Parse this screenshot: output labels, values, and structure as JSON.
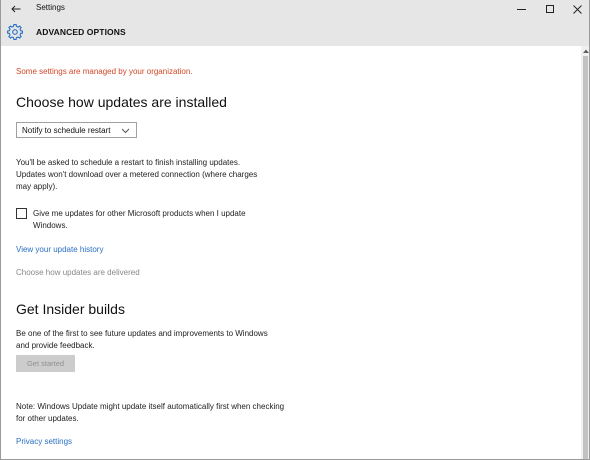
{
  "window": {
    "title": "Settings",
    "header_title": "ADVANCED OPTIONS"
  },
  "colors": {
    "warning": "#d24726",
    "link": "#2a6fc4",
    "disabled_text": "#888888",
    "header_bg": "#e6e6e6"
  },
  "icons": {
    "back": "back-arrow-icon",
    "minimize": "minimize-icon",
    "maximize": "maximize-icon",
    "close": "close-icon",
    "settings": "gear-icon",
    "dropdown": "chevron-down-icon"
  },
  "content": {
    "managed_notice": "Some settings are managed by your organization.",
    "updates_heading": "Choose how updates are installed",
    "update_mode": {
      "selected": "Notify to schedule restart"
    },
    "updates_description": "You'll be asked to schedule a restart to finish installing updates. Updates won't download over a metered connection (where charges may apply).",
    "other_products_checkbox": {
      "label": "Give me updates for other Microsoft products when I update Windows.",
      "checked": false
    },
    "history_link": "View your update history",
    "delivery_link": "Choose how updates are delivered",
    "insider_heading": "Get Insider builds",
    "insider_description": "Be one of the first to see future updates and improvements to Windows and provide feedback.",
    "get_started_button": "Get started",
    "note": "Note: Windows Update might update itself automatically first when checking for other updates.",
    "privacy_link": "Privacy settings"
  }
}
